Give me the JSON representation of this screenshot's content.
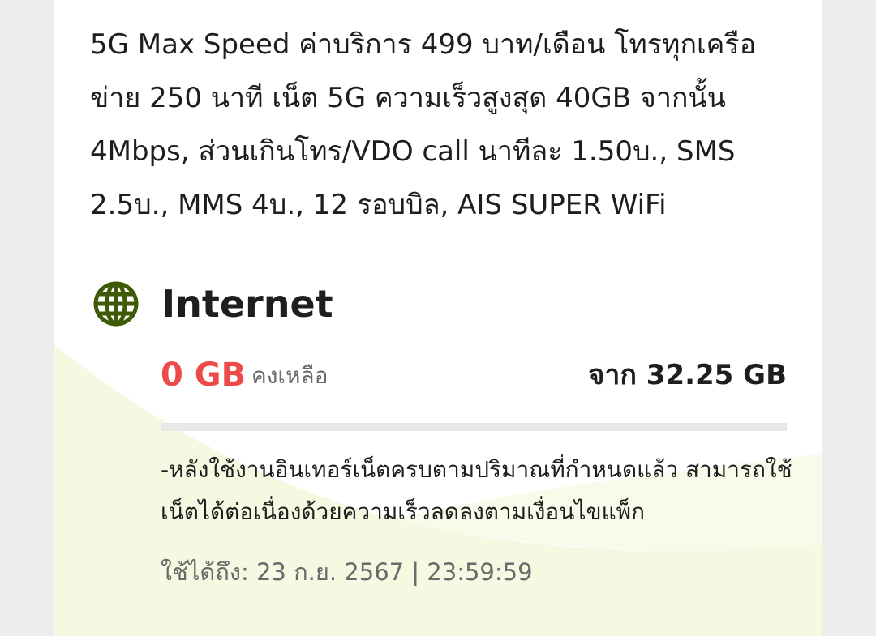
{
  "package": {
    "description": "5G Max Speed ค่าบริการ 499 บาท/เดือน โทรทุกเครือข่าย 250 นาที เน็ต 5G ความเร็วสูงสุด 40GB จากนั้น 4Mbps, ส่วนเกินโทร/VDO call นาทีละ 1.50บ., SMS 2.5บ., MMS 4บ., 12 รอบบิล, AIS SUPER WiFi"
  },
  "internet": {
    "icon": "globe-icon",
    "title": "Internet",
    "remaining_value": "0 GB",
    "remaining_label": "คงเหลือ",
    "total_text": "จาก 32.25 GB",
    "usage_remaining_fraction": 0,
    "note": "-หลังใช้งานอินเทอร์เน็ตครบตามปริมาณที่กำหนดแล้ว สามารถใช้เน็ตได้ต่อเนื่องด้วยความเร็วลดลงตามเงื่อนไขแพ็ก",
    "expiry": "ใช้ได้ถึง: 23 ก.ย. 2567 | 23:59:59"
  },
  "colors": {
    "accent_red": "#ee4a4a",
    "icon_green": "#3d5a06",
    "wave_green": "#f3f9e1"
  }
}
